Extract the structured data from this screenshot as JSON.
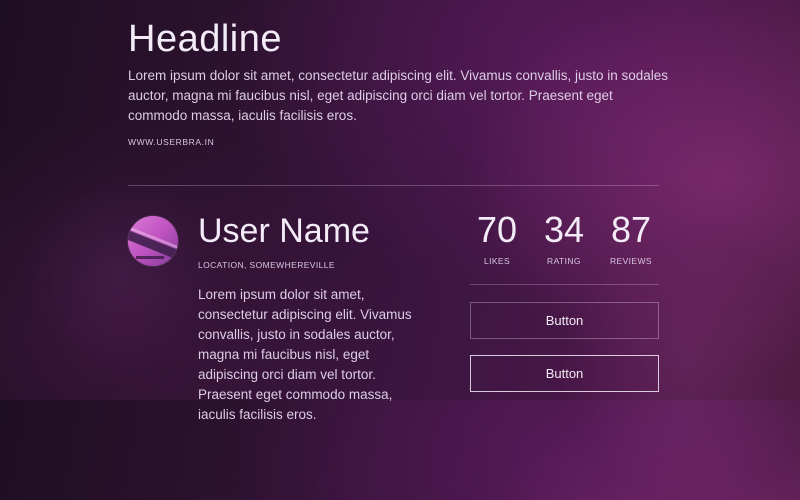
{
  "header": {
    "headline": "Headline",
    "intro": "Lorem ipsum dolor sit amet, consectetur adipiscing elit. Vivamus convallis, justo in sodales auctor, magna mi faucibus nisl, eget adipiscing orci diam vel tortor. Praesent eget commodo massa, iaculis facilisis eros.",
    "site_link": "WWW.USERBRA.IN"
  },
  "profile": {
    "avatar_icon": "user-avatar",
    "name": "User Name",
    "location": "LOCATION, SOMEWHEREVILLE",
    "bio": "Lorem ipsum dolor sit amet, consectetur adipiscing elit. Vivamus convallis, justo in sodales auctor, magna mi faucibus nisl, eget adipiscing orci diam vel tortor. Praesent eget commodo massa, iaculis facilisis eros."
  },
  "stats": {
    "likes": {
      "value": "70",
      "label": "LIKES"
    },
    "rating": {
      "value": "34",
      "label": "RATING"
    },
    "reviews": {
      "value": "87",
      "label": "REVIEWS"
    }
  },
  "actions": {
    "primary_label": "Button",
    "secondary_label": "Button"
  },
  "colors": {
    "text": "#f3ebf7",
    "background_dark": "#1f0f22",
    "background_accent": "#4a1848",
    "avatar_accent": "#e06dc4"
  }
}
